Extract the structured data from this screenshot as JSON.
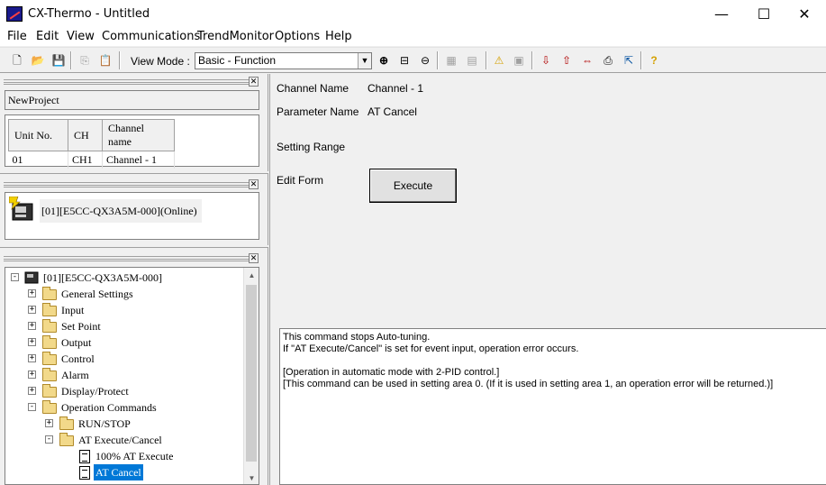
{
  "window": {
    "title": "CX-Thermo - Untitled",
    "minimize": "—",
    "maximize": "☐",
    "close": "✕"
  },
  "menu": [
    "File",
    "Edit",
    "View",
    "Communications",
    "TrendMonitor",
    "Options",
    "Help"
  ],
  "toolbar": {
    "view_mode_label": "View Mode :",
    "view_mode_value": "Basic - Function"
  },
  "project": {
    "name": "NewProject",
    "columns": [
      "Unit No.",
      "CH",
      "Channel name"
    ],
    "rows": [
      [
        "01",
        "CH1",
        "Channel - 1"
      ]
    ]
  },
  "device": {
    "label": "[01][E5CC-QX3A5M-000](Online)"
  },
  "tree": {
    "root": "[01][E5CC-QX3A5M-000]",
    "items": [
      "General Settings",
      "Input",
      "Set Point",
      "Output",
      "Control",
      "Alarm",
      "Display/Protect",
      "Operation Commands",
      "RUN/STOP",
      "AT Execute/Cancel",
      "100% AT Execute",
      "AT Cancel"
    ]
  },
  "params": {
    "channel_name_label": "Channel Name",
    "channel_name_value": "Channel - 1",
    "parameter_name_label": "Parameter Name",
    "parameter_name_value": "AT Cancel",
    "setting_range_label": "Setting Range",
    "edit_form_label": "Edit Form",
    "execute_label": "Execute"
  },
  "description": [
    "This command stops Auto-tuning.",
    "If \"AT Execute/Cancel\" is set for event input, operation error occurs.",
    "",
    "[Operation in automatic mode with 2-PID control.]",
    "[This command can be used in setting area 0. (If it is used in setting area 1, an operation error will be returned.)]"
  ]
}
